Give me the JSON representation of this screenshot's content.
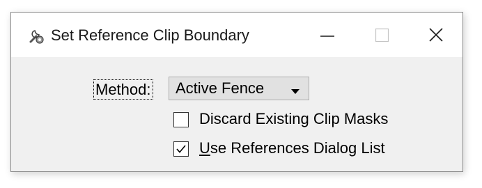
{
  "window": {
    "title": "Set Reference Clip Boundary",
    "icons": {
      "app": "wrench-gear-icon",
      "minimize": "minimize-icon",
      "maximize": "maximize-icon",
      "close": "close-icon"
    }
  },
  "form": {
    "method_label": "Method:",
    "method_value": "Active Fence",
    "method_dropdown_icon": "dropdown-arrow-icon",
    "options": [
      {
        "mnemonic": "",
        "rest": "Discard Existing Clip Masks",
        "checked": false
      },
      {
        "mnemonic": "U",
        "rest": "se References Dialog List",
        "checked": true
      }
    ]
  },
  "colors": {
    "dialog_bg": "#f0f0f0",
    "titlebar_bg": "#ffffff",
    "border": "#8a8a8a",
    "control_bg": "#e1e1e1"
  }
}
